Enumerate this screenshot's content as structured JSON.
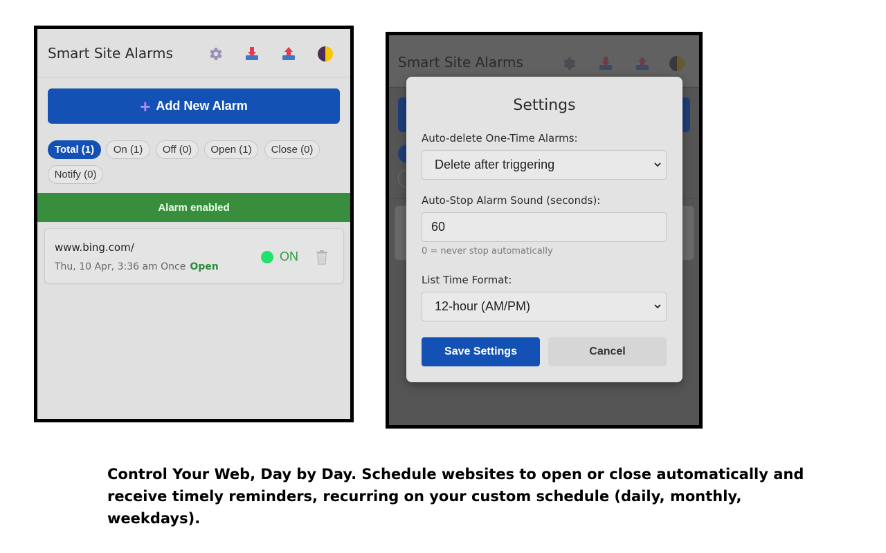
{
  "app": {
    "title": "Smart Site Alarms",
    "header_icons": [
      "gear-icon",
      "import-icon",
      "export-icon",
      "theme-toggle-icon"
    ]
  },
  "main": {
    "add_button_label": "Add New Alarm",
    "filters": [
      {
        "label": "Total (1)",
        "active": true
      },
      {
        "label": "On (1)",
        "active": false
      },
      {
        "label": "Off (0)",
        "active": false
      },
      {
        "label": "Open (1)",
        "active": false
      },
      {
        "label": "Close (0)",
        "active": false
      },
      {
        "label": "Notify (0)",
        "active": false
      }
    ],
    "banner": "Alarm enabled",
    "alarm": {
      "url": "www.bing.com/",
      "schedule": "Thu, 10 Apr, 3:36 am Once",
      "action": "Open",
      "status": "ON"
    }
  },
  "settings": {
    "title": "Settings",
    "auto_delete_label": "Auto-delete One-Time Alarms:",
    "auto_delete_value": "Delete after triggering",
    "auto_stop_label": "Auto-Stop Alarm Sound (seconds):",
    "auto_stop_value": "60",
    "auto_stop_hint": "0 = never stop automatically",
    "time_format_label": "List Time Format:",
    "time_format_value": "12-hour (AM/PM)",
    "save_label": "Save Settings",
    "cancel_label": "Cancel"
  },
  "caption": {
    "line1": "Control Your Web, Day by Day. Schedule websites to open or close automatically and",
    "line2": "receive timely reminders, recurring on your custom schedule (daily, monthly, weekdays)."
  },
  "colors": {
    "accent": "#1351b4",
    "success_banner": "#388e3c",
    "toggle_on": "#1ee36a"
  }
}
